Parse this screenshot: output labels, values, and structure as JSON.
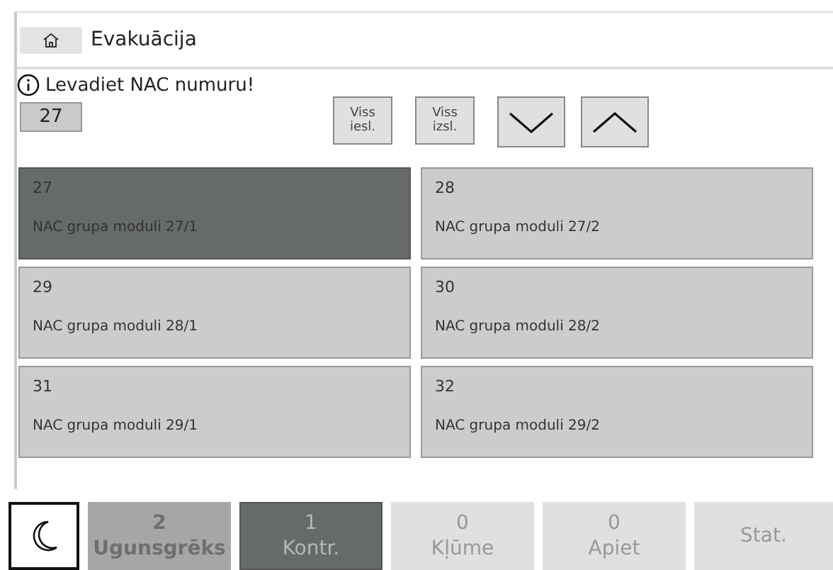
{
  "header": {
    "title": "Evakuācija"
  },
  "prompt": {
    "text": "Levadiet NAC numuru!"
  },
  "number_field": {
    "value": "27"
  },
  "buttons": [
    {
      "kind": "text",
      "label": "Viss\niesl."
    },
    {
      "kind": "text",
      "label": "Viss\nizsl."
    },
    {
      "kind": "down"
    },
    {
      "kind": "up"
    }
  ],
  "groups": [
    {
      "number": "27",
      "name": "NAC grupa moduli 27/1",
      "selected": true
    },
    {
      "number": "28",
      "name": "NAC grupa moduli 27/2",
      "selected": false
    },
    {
      "number": "29",
      "name": "NAC grupa moduli 28/1",
      "selected": false
    },
    {
      "number": "30",
      "name": "NAC grupa moduli 28/2",
      "selected": false
    },
    {
      "number": "31",
      "name": "NAC grupa moduli 29/1",
      "selected": false
    },
    {
      "number": "32",
      "name": "NAC grupa moduli 29/2",
      "selected": false
    }
  ],
  "status_tabs": [
    {
      "count": "2",
      "label": "Ugunsgrēks",
      "alarm": true,
      "selected": false
    },
    {
      "count": "1",
      "label": "Kontr.",
      "alarm": false,
      "selected": true
    },
    {
      "count": "0",
      "label": "Kļūme",
      "alarm": false,
      "selected": false
    },
    {
      "count": "0",
      "label": "Apiet",
      "alarm": false,
      "selected": false
    },
    {
      "label": "Stat.",
      "alarm": false,
      "selected": false
    }
  ]
}
